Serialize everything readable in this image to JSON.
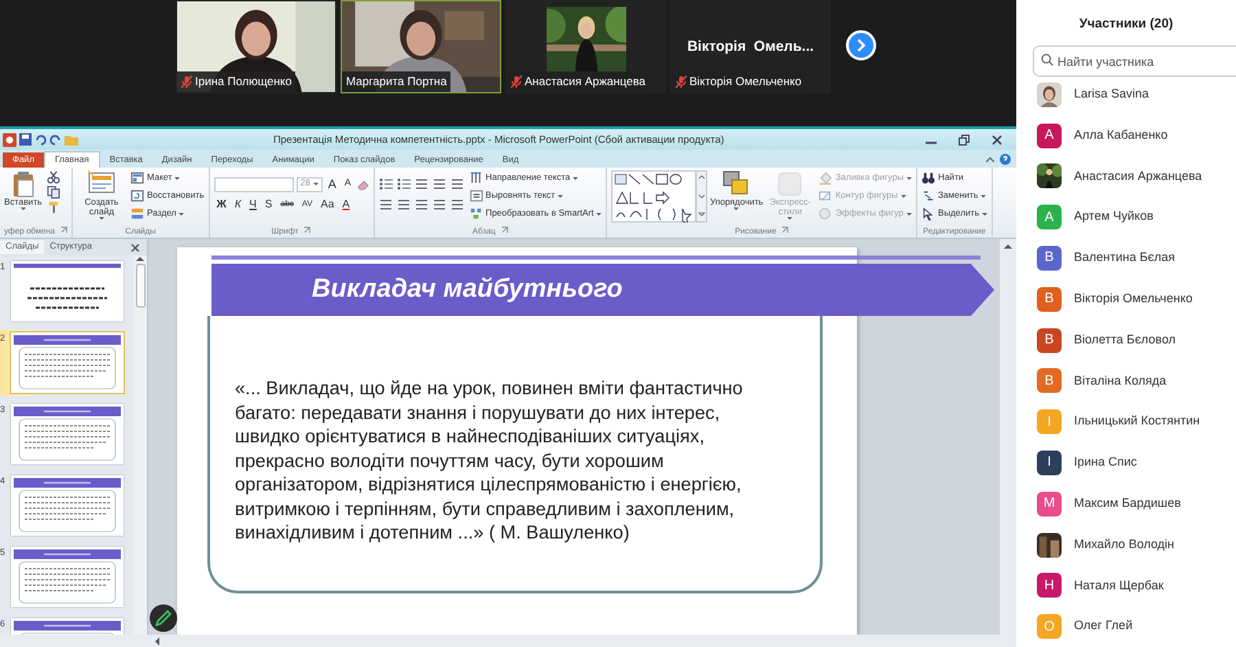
{
  "video_strip": {
    "tiles": [
      {
        "kind": "picture",
        "name": "Ірина Полющенко",
        "muted": true,
        "speaking": false
      },
      {
        "kind": "picture",
        "name": "Маргарита Портна",
        "muted": false,
        "speaking": true
      },
      {
        "kind": "inset-picture",
        "name": "Анастасия Аржанцева",
        "muted": true,
        "speaking": false
      },
      {
        "kind": "name",
        "display": "Вікторія  Омель...",
        "name": "Вікторія Омельченко",
        "muted": true,
        "speaking": false
      }
    ]
  },
  "powerpoint": {
    "title": "Презентація Методична компетентність.pptx - Microsoft PowerPoint (Сбой активации продукта)",
    "tabs": [
      {
        "label": "Файл",
        "kind": "file",
        "selected": false
      },
      {
        "label": "Главная",
        "kind": "tab",
        "selected": true
      },
      {
        "label": "Вставка",
        "kind": "tab",
        "selected": false
      },
      {
        "label": "Дизайн",
        "kind": "tab",
        "selected": false
      },
      {
        "label": "Переходы",
        "kind": "tab",
        "selected": false
      },
      {
        "label": "Анимации",
        "kind": "tab",
        "selected": false
      },
      {
        "label": "Показ слайдов",
        "kind": "tab",
        "selected": false
      },
      {
        "label": "Рецензирование",
        "kind": "tab",
        "selected": false
      },
      {
        "label": "Вид",
        "kind": "tab",
        "selected": false
      }
    ],
    "ribbon": [
      {
        "kind": "clipboard",
        "label": "уфер обмена",
        "items": [
          {
            "label": "Вставить",
            "dropdown": true,
            "disabled": false
          }
        ]
      },
      {
        "kind": "slides",
        "label": "Слайды",
        "items": [
          {
            "label": "Создать слайд",
            "dropdown": true,
            "disabled": false
          },
          {
            "label": "Макет",
            "dropdown": true,
            "disabled": false
          },
          {
            "label": "Восстановить",
            "dropdown": false,
            "disabled": false
          },
          {
            "label": "Раздел",
            "dropdown": true,
            "disabled": false
          }
        ]
      },
      {
        "kind": "font",
        "label": "Шрифт",
        "font_size": "28",
        "size_buttons": [
          "A",
          "A"
        ],
        "format_buttons": [
          "Ж",
          "К",
          "Ч",
          "S",
          "abc",
          "AV",
          "Aa",
          "A"
        ]
      },
      {
        "kind": "paragraph",
        "label": "Абзац",
        "items": [
          {
            "label": "Направление текста",
            "dropdown": true,
            "disabled": false
          },
          {
            "label": "Выровнять текст",
            "dropdown": true,
            "disabled": false
          },
          {
            "label": "Преобразовать в SmartArt",
            "dropdown": true,
            "disabled": false
          }
        ]
      },
      {
        "kind": "drawing",
        "label": "Рисование",
        "items": [
          {
            "label": "Упорядочить",
            "dropdown": true,
            "disabled": false
          },
          {
            "label": "Экспресс-стили",
            "dropdown": true,
            "disabled": true
          },
          {
            "label": "Заливка фигуры",
            "dropdown": true,
            "disabled": true
          },
          {
            "label": "Контур фигуры",
            "dropdown": true,
            "disabled": true
          },
          {
            "label": "Эффекты фигур",
            "dropdown": true,
            "disabled": true
          }
        ]
      },
      {
        "kind": "editing",
        "label": "Редактирование",
        "items": [
          {
            "label": "Найти",
            "dropdown": false,
            "disabled": false
          },
          {
            "label": "Заменить",
            "dropdown": true,
            "disabled": false
          },
          {
            "label": "Выделить",
            "dropdown": true,
            "disabled": false
          }
        ]
      }
    ],
    "slide_pane": {
      "tabs": [
        {
          "label": "Слайды",
          "selected": true
        },
        {
          "label": "Структура",
          "selected": false
        }
      ],
      "thumbnails": [
        {
          "number": "1",
          "kind": "title",
          "selected": false
        },
        {
          "number": "2",
          "kind": "content",
          "selected": true
        },
        {
          "number": "3",
          "kind": "content",
          "selected": false
        },
        {
          "number": "4",
          "kind": "content",
          "selected": false
        },
        {
          "number": "5",
          "kind": "content",
          "selected": false
        },
        {
          "number": "6",
          "kind": "content",
          "selected": false
        }
      ]
    },
    "slide": {
      "title": "Викладач майбутнього",
      "quote": "«... Викладач, що йде на урок, повинен вміти фантастично\nбагато: передавати знання і порушувати до них інтерес,\nшвидко орієнтуватися в найнесподіваніших ситуаціях,\nпрекрасно володіти почуттям часу, бути хорошим\nорганізатором, відрізнятися цілеспрямованістю і енергією,\nвитримкою і терпінням, бути справедливим і захопленим,\nвинахідливим і дотепним ...» ( М. Вашуленко)"
    }
  },
  "participants": {
    "title": "Участники (20)",
    "search": {
      "placeholder": "Найти участника"
    },
    "people": [
      {
        "name": "Larisa Savina"
      },
      {
        "name": "Алла Кабаненко",
        "avatar": {
          "kind": "letter",
          "letter": "А",
          "color": "#c8185c"
        }
      },
      {
        "name": "Анастасия Аржанцева"
      },
      {
        "name": "Артем Чуйков",
        "avatar": {
          "kind": "letter",
          "letter": "А",
          "color": "#2bb24c"
        }
      },
      {
        "name": "Валентина Бєлая",
        "avatar": {
          "kind": "letter",
          "letter": "В",
          "color": "#5b66cc"
        }
      },
      {
        "name": "Вікторія Омельченко",
        "avatar": {
          "kind": "letter",
          "letter": "В",
          "color": "#e0601e"
        }
      },
      {
        "name": "Віолетта Бєловол",
        "avatar": {
          "kind": "letter",
          "letter": "В",
          "color": "#c9461f"
        }
      },
      {
        "name": "Віталіна Коляда",
        "avatar": {
          "kind": "letter",
          "letter": "В",
          "color": "#e26a22"
        }
      },
      {
        "name": "Ільницький Костянтин",
        "avatar": {
          "kind": "letter",
          "letter": "І",
          "color": "#f5a623"
        }
      },
      {
        "name": "Ірина Спис",
        "avatar": {
          "kind": "letter",
          "letter": "І",
          "color": "#2e3f5e"
        }
      },
      {
        "name": "Максим Бардишев",
        "avatar": {
          "kind": "letter",
          "letter": "М",
          "color": "#e84c8c"
        }
      },
      {
        "name": "Михайло Володін"
      },
      {
        "name": "Наталя Щербак",
        "avatar": {
          "kind": "letter",
          "letter": "Н",
          "color": "#c8186a"
        }
      },
      {
        "name": "Олег Глей",
        "avatar": {
          "kind": "letter",
          "letter": "О",
          "color": "#f5a623"
        }
      }
    ]
  }
}
